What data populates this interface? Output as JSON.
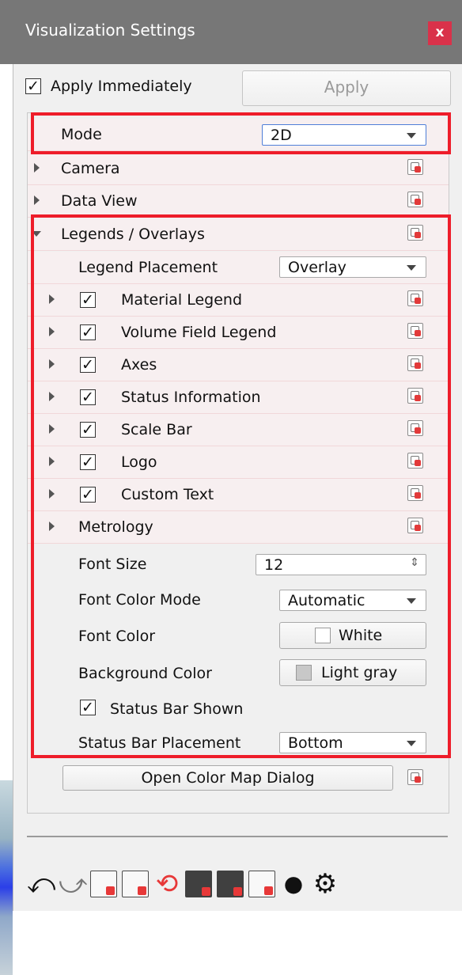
{
  "window": {
    "title": "Visualization Settings",
    "close_label": "x"
  },
  "top": {
    "apply_immediately_label": "Apply Immediately",
    "apply_immediately_checked": true,
    "apply_button_label": "Apply"
  },
  "tree": {
    "mode_label": "Mode",
    "mode_value": "2D",
    "camera_label": "Camera",
    "data_view_label": "Data View",
    "legends_label": "Legends / Overlays",
    "legend_placement_label": "Legend Placement",
    "legend_placement_value": "Overlay",
    "items": [
      {
        "label": "Material Legend",
        "checked": true
      },
      {
        "label": "Volume Field Legend",
        "checked": true
      },
      {
        "label": "Axes",
        "checked": true
      },
      {
        "label": "Status Information",
        "checked": true
      },
      {
        "label": "Scale Bar",
        "checked": true
      },
      {
        "label": "Logo",
        "checked": true
      },
      {
        "label": "Custom Text",
        "checked": true
      }
    ],
    "metrology_label": "Metrology",
    "font_size_label": "Font Size",
    "font_size_value": "12",
    "font_color_mode_label": "Font Color Mode",
    "font_color_mode_value": "Automatic",
    "font_color_label": "Font Color",
    "font_color_value": "White",
    "font_color_swatch": "#ffffff",
    "background_color_label": "Background Color",
    "background_color_value": "Light gray",
    "background_color_swatch": "#c8c8c8",
    "status_bar_shown_label": "Status Bar Shown",
    "status_bar_shown_checked": true,
    "status_bar_placement_label": "Status Bar Placement",
    "status_bar_placement_value": "Bottom",
    "open_color_map_label": "Open Color Map Dialog"
  },
  "toolbar": {
    "icons": [
      "undo-icon",
      "redo-icon",
      "export-settings-icon",
      "import-settings-icon",
      "reset-settings-icon",
      "save-preset-icon",
      "load-preset-icon",
      "script-icon",
      "visibility-icon",
      "settings-gear-icon"
    ]
  },
  "colors": {
    "highlight_red": "#ee1d2a",
    "title_bg": "#777777",
    "close_red": "#d9314a"
  }
}
